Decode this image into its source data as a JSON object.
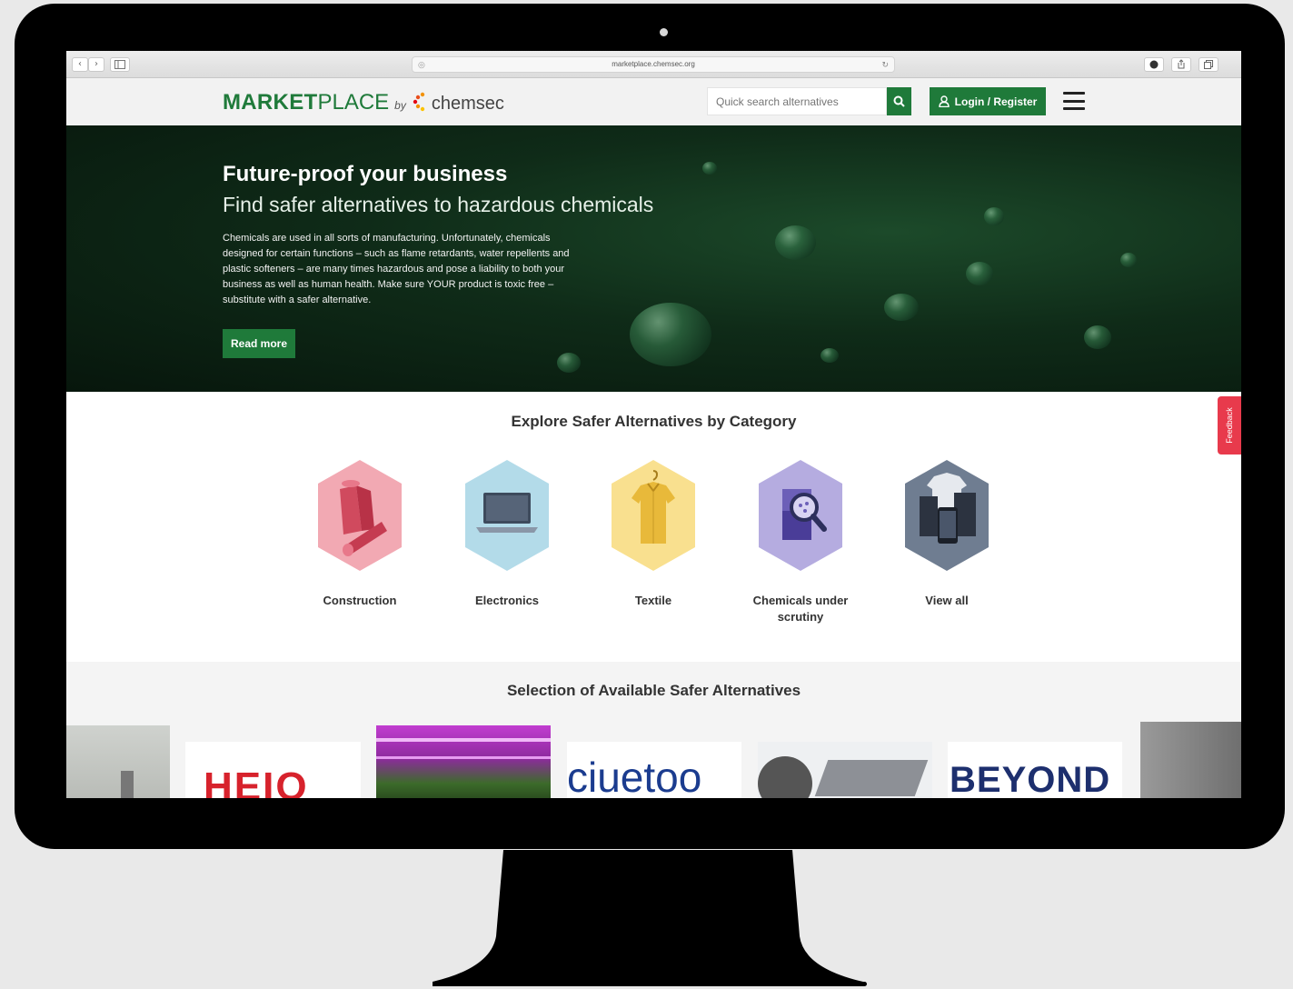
{
  "browser": {
    "url": "marketplace.chemsec.org",
    "nav_back": "‹",
    "nav_forward": "›"
  },
  "header": {
    "logo_market": "MARKET",
    "logo_place": "PLACE",
    "logo_by": "by",
    "logo_brand": "chemsec",
    "search_placeholder": "Quick search alternatives",
    "login_label": "Login / Register"
  },
  "hero": {
    "title": "Future-proof your business",
    "subtitle": "Find safer alternatives to hazardous chemicals",
    "body": "Chemicals are used in all sorts of manufacturing. Unfortunately, chemicals designed for certain functions – such as flame retardants, water repellents and plastic softeners – are many times hazardous and pose a liability to both your business as well as human health. Make sure YOUR product is toxic free – substitute with a safer alternative.",
    "cta_label": "Read more"
  },
  "categories": {
    "title": "Explore Safer Alternatives by Category",
    "items": [
      {
        "label": "Construction",
        "color": "#f2a9b3",
        "icon": "construction-materials-icon"
      },
      {
        "label": "Electronics",
        "color": "#b3dbe9",
        "icon": "laptop-icon"
      },
      {
        "label": "Textile",
        "color": "#f9e08f",
        "icon": "shirt-icon"
      },
      {
        "label": "Chemicals under scrutiny",
        "color": "#b5ace0",
        "icon": "magnifier-beaker-icon"
      },
      {
        "label": "View all",
        "color": "#6f7d91",
        "icon": "all-categories-icon"
      }
    ]
  },
  "selection": {
    "title": "Selection of Available Safer Alternatives",
    "brand_heiq": "HEIQ",
    "brand_ciuetoo": "ciuetoo",
    "brand_beyond": "BEYOND"
  },
  "feedback_label": "Feedback",
  "colors": {
    "brand_green": "#1f7a3a",
    "feedback_red": "#e83a4c"
  }
}
